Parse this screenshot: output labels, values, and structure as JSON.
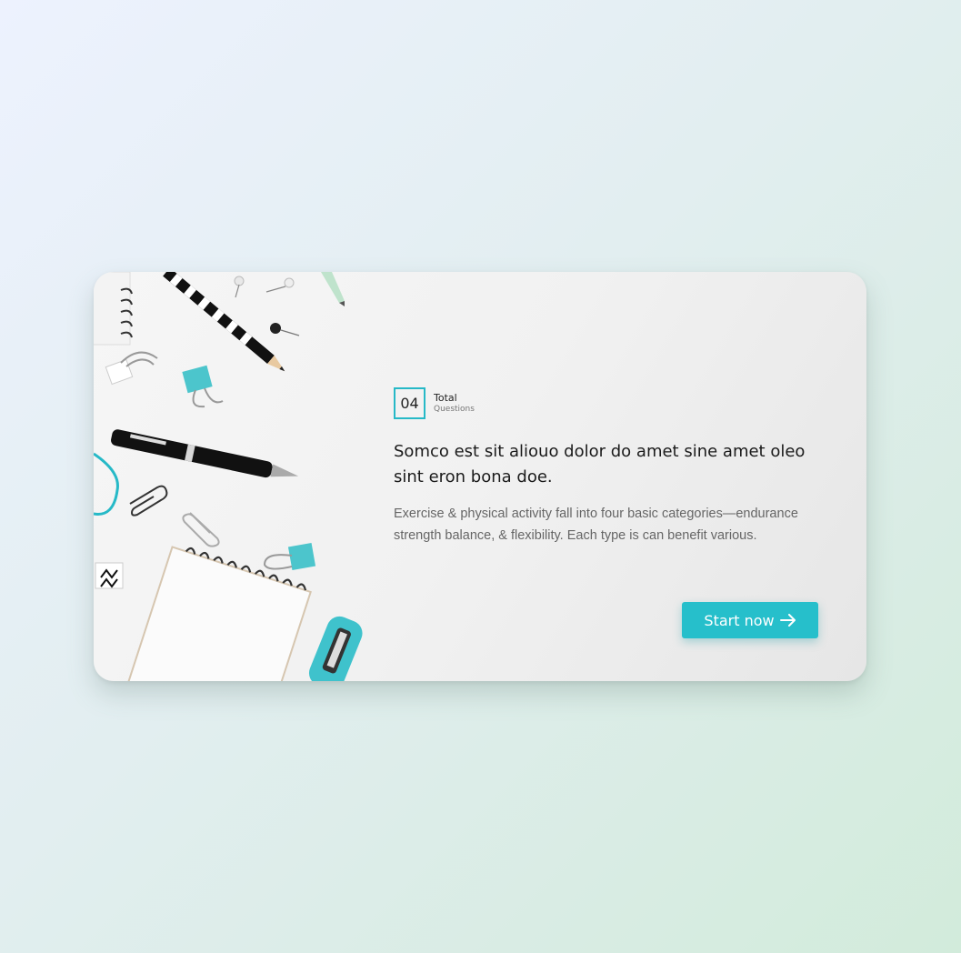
{
  "quiz": {
    "count": "04",
    "count_label": "Total",
    "count_sublabel": "Questions",
    "title": "Somco est sit aliouo dolor do amet sine amet oleo sint eron bona doe.",
    "description": "Exercise & physical activity fall into four basic categories—endurance strength balance, & flexibility. Each type is can benefit various.",
    "start_label": "Start now"
  },
  "colors": {
    "accent": "#26bfcb",
    "heading": "#1b1b1b",
    "body_text": "#666666"
  },
  "icons": {
    "start_button": "arrow-right-icon",
    "illustration": "stationery-desk-image"
  }
}
